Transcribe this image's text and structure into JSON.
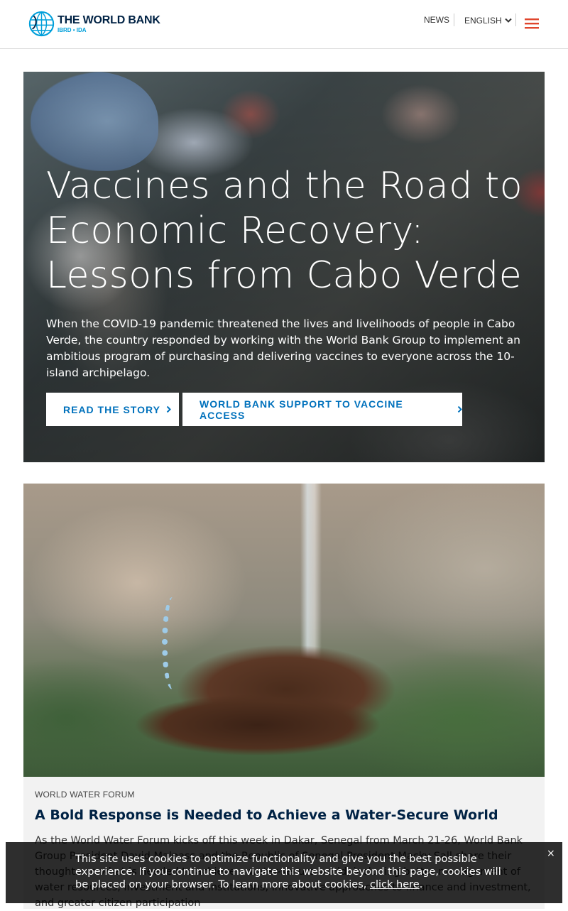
{
  "header": {
    "logo_name": "THE WORLD BANK",
    "logo_sub": "IBRD • IDA",
    "nav_news": "NEWS",
    "nav_language": "ENGLISH",
    "menu_icon": "hamburger-icon",
    "brand_color": "#002244",
    "accent_color": "#009fda",
    "menu_color": "#e0462d"
  },
  "hero": {
    "title": "Vaccines and the Road to Economic Recovery: Lessons from Cabo Verde",
    "description": "When the COVID-19 pandemic threatened the lives and livelihoods of people in Cabo Verde, the country responded by working with the World Bank Group to implement an ambitious program of purchasing and delivering vaccines to everyone across the 10-island archipelago.",
    "button_story": "READ THE STORY",
    "button_support": "WORLD BANK SUPPORT TO VACCINE ACCESS",
    "button_color": "#0071bc"
  },
  "card": {
    "tag": "WORLD WATER FORUM",
    "title": "A Bold Response is Needed to Achieve a Water-Secure World",
    "text": "As the World Water Forum kicks off this week in Dakar, Senegal from March 21-26, World Bank Group President David Malpass and the Republic of Senegal President Macky Sall share their thoughts on what is needed to achieve a water-secure world, including better management of water resources, investment and institutions, innovative approaches to finance and investment, and greater citizen participation"
  },
  "cookie": {
    "text": "This site uses cookies to optimize functionality and give you the best possible experience. If you continue to navigate this website beyond this page, cookies will be placed on your browser. To learn more about cookies,",
    "link": "click here",
    "after_link": ".",
    "close": "×"
  }
}
